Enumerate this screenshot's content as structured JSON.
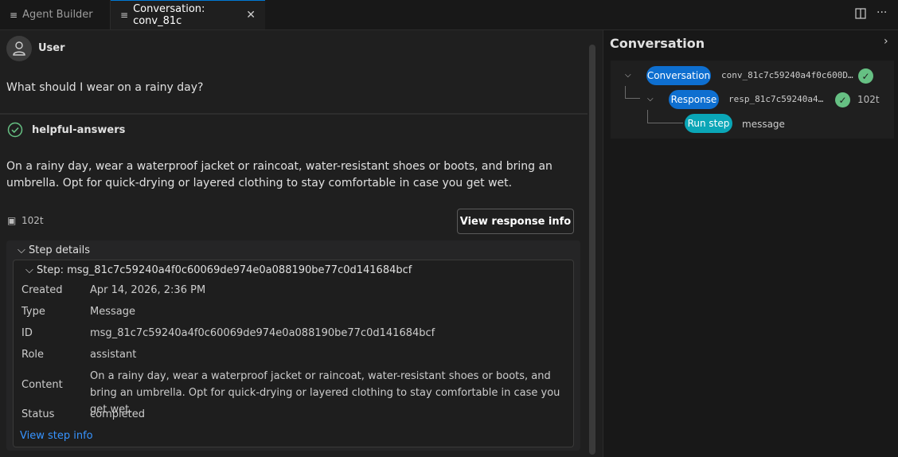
{
  "tabs": [
    {
      "label": "Agent Builder",
      "icon": "menu-lines-icon"
    },
    {
      "label": "Conversation: conv_81c",
      "icon": "menu-lines-icon"
    }
  ],
  "toolbar": {
    "split_icon": "split-editor-icon",
    "more_icon": "ellipsis-icon"
  },
  "user": {
    "name": "User",
    "message": "What should I wear on a rainy day?"
  },
  "agent": {
    "name": "helpful-answers",
    "answer": "On a rainy day, wear a waterproof jacket or raincoat, water-resistant shoes or boots, and bring an umbrella. Opt for quick-drying or layered clothing to stay comfortable in case you get wet.",
    "tokens": "102t",
    "response_button": "View response info"
  },
  "step_details": {
    "header": "Step details",
    "step_title": "Step: msg_81c7c59240a4f0c60069de974e0a088190be77c0d141684bcf",
    "rows": {
      "created": {
        "label": "Created",
        "value": "Apr 14, 2026, 2:36 PM"
      },
      "type": {
        "label": "Type",
        "value": "Message"
      },
      "id": {
        "label": "ID",
        "value": "msg_81c7c59240a4f0c60069de974e0a088190be77c0d141684bcf"
      },
      "role": {
        "label": "Role",
        "value": "assistant"
      },
      "content": {
        "label": "Content",
        "value": "On a rainy day, wear a waterproof jacket or raincoat, water-resistant shoes or boots, and bring an umbrella. Opt for quick-drying or layered clothing to stay comfortable in case you get wet."
      },
      "status": {
        "label": "Status",
        "value": "completed"
      }
    },
    "view_step_link": "View step info"
  },
  "conversation_panel": {
    "title": "Conversation",
    "tree": {
      "conversation": {
        "pill": "Conversation",
        "id": "conv_81c7c59240a4f0c600D…"
      },
      "response": {
        "pill": "Response",
        "id": "resp_81c7c59240a4…",
        "tokens": "102t"
      },
      "run_step": {
        "pill": "Run step",
        "label": "message"
      }
    }
  },
  "colors": {
    "accent": "#0e6fd0",
    "teal": "#0aa6b7",
    "success": "#66c083",
    "link": "#3794ff"
  }
}
